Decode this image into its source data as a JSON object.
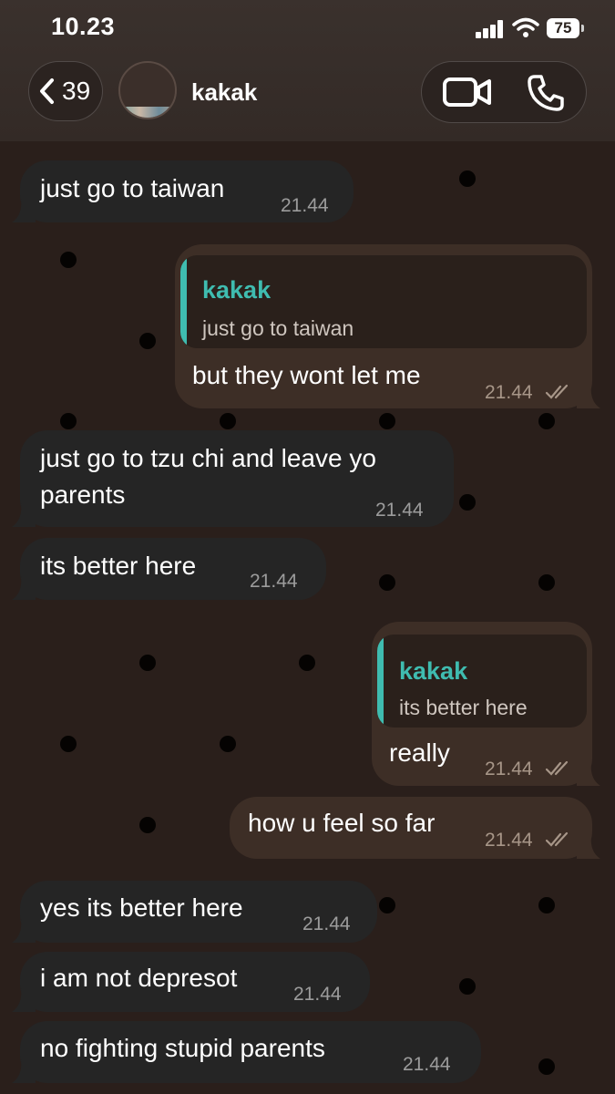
{
  "status_bar": {
    "time": "10.23",
    "battery": "75"
  },
  "header": {
    "back_count": "39",
    "contact_name": "kakak",
    "icons": {
      "back": "chevron-left-icon",
      "video": "video-camera-icon",
      "phone": "phone-icon"
    }
  },
  "colors": {
    "background": "#2a1f1b",
    "incoming_bubble": "#252525",
    "outgoing_bubble": "#3d2e26",
    "reply_accent": "#3fbcb0"
  },
  "messages": [
    {
      "direction": "in",
      "lines": [
        "just go to taiwan"
      ],
      "time": "21.44"
    },
    {
      "direction": "out",
      "reply": {
        "name": "kakak",
        "text": "just go to taiwan"
      },
      "lines": [
        "but they wont let me"
      ],
      "time": "21.44",
      "read": true
    },
    {
      "direction": "in",
      "lines": [
        "just go to tzu chi and leave yo",
        "parents"
      ],
      "time": "21.44"
    },
    {
      "direction": "in",
      "lines": [
        "its better here"
      ],
      "time": "21.44"
    },
    {
      "direction": "out",
      "reply": {
        "name": "kakak",
        "text": "its better here"
      },
      "lines": [
        "really"
      ],
      "time": "21.44",
      "read": true
    },
    {
      "direction": "out",
      "lines": [
        "how u feel so far"
      ],
      "time": "21.44",
      "read": true
    },
    {
      "direction": "in",
      "lines": [
        "yes its better here"
      ],
      "time": "21.44"
    },
    {
      "direction": "in",
      "lines": [
        "i am not depresot"
      ],
      "time": "21.44"
    },
    {
      "direction": "in",
      "lines": [
        "no fighting stupid parents"
      ],
      "time": "21.44"
    }
  ]
}
